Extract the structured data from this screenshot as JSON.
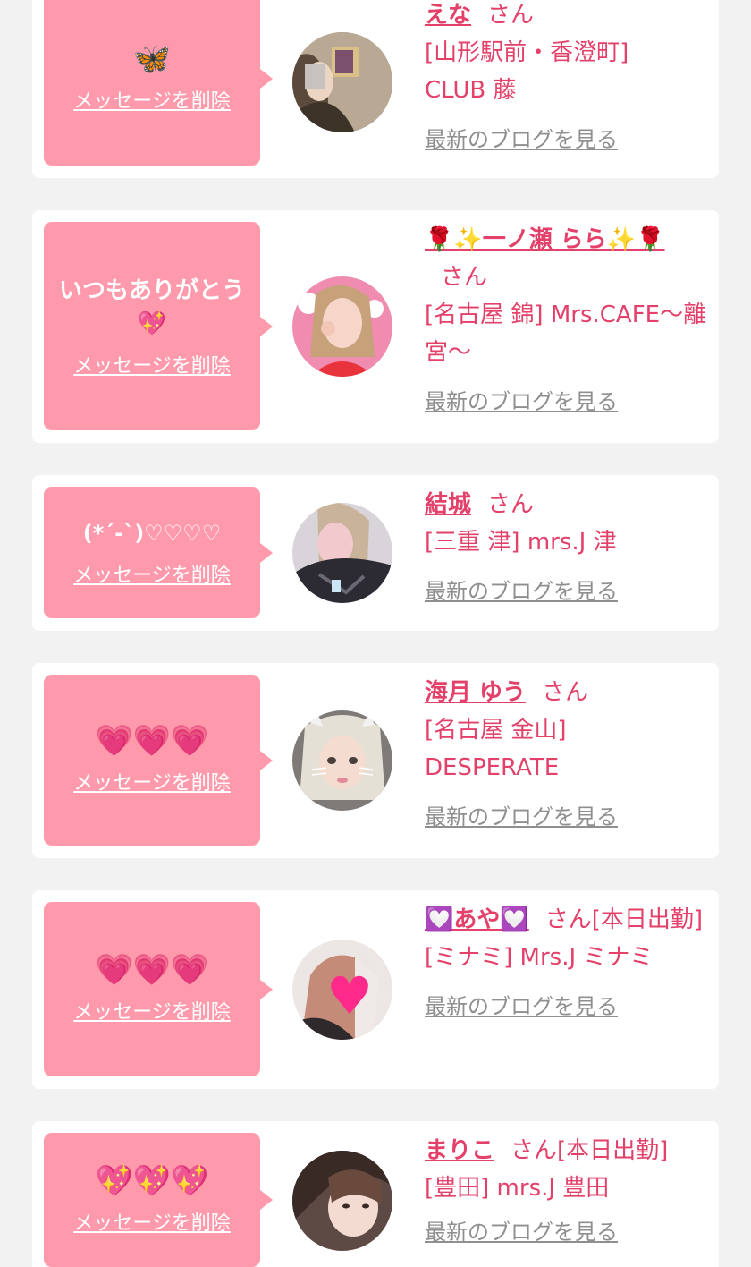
{
  "cards": [
    {
      "message": "🦋",
      "delete_label": "メッセージを削除",
      "name": "えな",
      "san": "さん",
      "shop": "[山形駅前・香澄町] CLUB 藤",
      "blog_label": "最新のブログを見る"
    },
    {
      "message": "いつもありがとう💖",
      "delete_label": "メッセージを削除",
      "name": "🌹✨一ノ瀬 らら✨🌹",
      "san": "さん",
      "shop": "[名古屋 錦] Mrs.CAFE〜離宮〜",
      "blog_label": "最新のブログを見る"
    },
    {
      "message": "(*´-`)♡♡♡♡",
      "delete_label": "メッセージを削除",
      "name": "結城",
      "san": "さん",
      "shop": "[三重 津] mrs.J 津",
      "blog_label": "最新のブログを見る"
    },
    {
      "message": "💗💗💗",
      "delete_label": "メッセージを削除",
      "name": "海月 ゆう",
      "san": "さん",
      "shop": "[名古屋 金山] DESPERATE",
      "blog_label": "最新のブログを見る"
    },
    {
      "message": "💗💗💗",
      "delete_label": "メッセージを削除",
      "name": "💟あや💟",
      "san": "さん[本日出勤]",
      "shop": "[ミナミ] Mrs.J ミナミ",
      "blog_label": "最新のブログを見る"
    },
    {
      "message": "💖💖💖",
      "delete_label": "メッセージを削除",
      "name": "まりこ",
      "san": "さん[本日出勤]",
      "shop": "[豊田] mrs.J 豊田",
      "blog_label": "最新のブログを見る"
    }
  ],
  "colors": {
    "page_bg": "#f2f2f2",
    "card_bg": "#ffffff",
    "bubble_bg": "#ff9aac",
    "name_color": "#e3416a",
    "link_gray": "#8f8f8f"
  }
}
